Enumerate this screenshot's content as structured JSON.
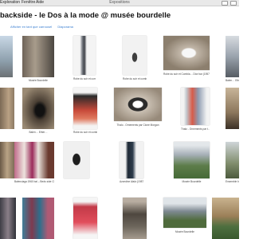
{
  "menubar": {
    "items": [
      "Exploration",
      "Fenêtre",
      "Aide"
    ],
    "window_title": "Expositions"
  },
  "page": {
    "title": "backside - le Dos à la mode @ musée bourdelle",
    "links": [
      "Afficher en tant que carrousel",
      "Diaporama"
    ]
  },
  "thumbnails": {
    "captions": [
      "",
      "Musée Bourdelle",
      "",
      "Robe du soir et comble…",
      "Robe du soir et comble…",
      "Robe du soir et Combla… Dior bar (1957…",
      "",
      "Balen… Ether…",
      "",
      "Balen… Ether…",
      "Robe du soir et comble…",
      "",
      "Thalo - Ornements par Clone Morgan",
      "Thalo - Ornements par t…",
      "",
      "Balenciaga 1960 bal – Beds side Chr…",
      "",
      "Azzedine Alaïa (1987) …",
      "Azzedine Alaïa (1987)…",
      "",
      "Musée Bourdelle",
      "Ensemble bird",
      "",
      "",
      "",
      "",
      "Musée Bourdelle",
      ""
    ]
  }
}
